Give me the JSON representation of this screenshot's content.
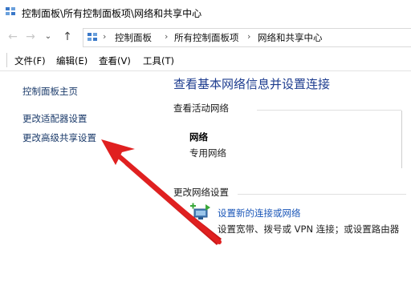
{
  "window": {
    "title": "控制面板\\所有控制面板项\\网络和共享中心"
  },
  "address_bar": {
    "back_icon": "arrow-left-icon",
    "forward_icon": "arrow-right-icon",
    "dropdown_icon": "chevron-down-icon",
    "up_icon": "arrow-up-icon",
    "crumbs": [
      "控制面板",
      "所有控制面板项",
      "网络和共享中心"
    ]
  },
  "menu": {
    "items": [
      "文件(F)",
      "编辑(E)",
      "查看(V)",
      "工具(T)"
    ]
  },
  "sidebar": {
    "items": [
      "控制面板主页",
      "更改适配器设置",
      "更改高级共享设置"
    ]
  },
  "main": {
    "heading": "查看基本网络信息并设置连接",
    "active_networks_label": "查看活动网络",
    "network": {
      "name": "网络",
      "type": "专用网络"
    },
    "change_settings_label": "更改网络设置",
    "setup": {
      "link": "设置新的连接或网络",
      "description": "设置宽带、拨号或 VPN 连接；或设置路由器"
    }
  },
  "colors": {
    "heading": "#1e3d8f",
    "link": "#1a56b8",
    "annotation_arrow": "#e02020"
  }
}
